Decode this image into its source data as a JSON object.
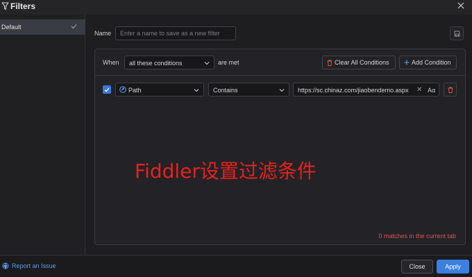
{
  "window": {
    "title": "Filters",
    "close_icon": "close-icon"
  },
  "sidebar": {
    "items": [
      {
        "label": "Default",
        "selected": true,
        "icon": "check-icon"
      }
    ]
  },
  "name_field": {
    "label": "Name",
    "placeholder": "Enter a name to save as a new filter",
    "value": ""
  },
  "conditions": {
    "when_label": "When",
    "match_mode": "all these conditions",
    "are_met_label": "are met",
    "clear_all_label": "Clear All Conditions",
    "add_label": "Add Condition",
    "rows": [
      {
        "checked": true,
        "field": "Path",
        "operator": "Contains",
        "value": "https://sc.chinaz.com/jiaobendemo.aspx",
        "case_label": "Aα"
      }
    ],
    "matches_text": "0 matches in the current tab"
  },
  "overlay_text": "Fiddler设置过滤条件",
  "footer": {
    "report_label": "Report an Issue",
    "close_label": "Close",
    "apply_label": "Apply"
  },
  "colors": {
    "accent": "#3b7fe0",
    "danger": "#d9534f",
    "overlay": "#e8201c"
  }
}
